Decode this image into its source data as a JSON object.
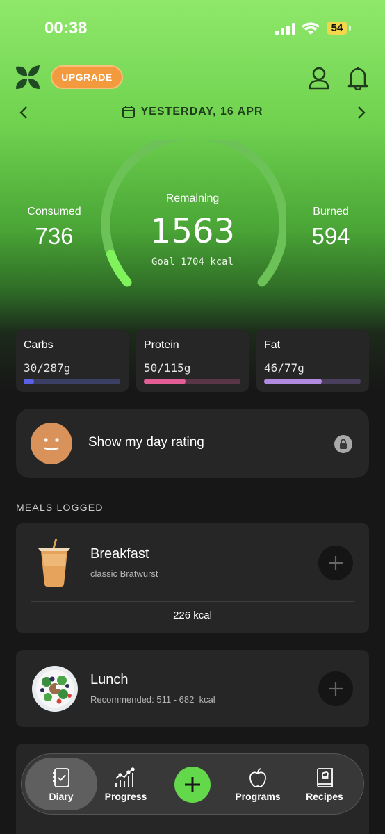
{
  "status": {
    "time": "00:38",
    "battery": "54"
  },
  "header": {
    "upgrade_label": "UPGRADE",
    "date": "YESTERDAY, 16 APR"
  },
  "stats": {
    "consumed_label": "Consumed",
    "consumed": "736",
    "remaining_label": "Remaining",
    "remaining": "1563",
    "goal": "Goal 1704 kcal",
    "burned_label": "Burned",
    "burned": "594",
    "remaining_progress": 0.08
  },
  "macros": [
    {
      "name": "Carbs",
      "value": "30/287g",
      "progress": 0.105,
      "color": "#5a61e6",
      "track": "#3b3f63"
    },
    {
      "name": "Protein",
      "value": "50/115g",
      "progress": 0.435,
      "color": "#e35e95",
      "track": "#5a3547"
    },
    {
      "name": "Fat",
      "value": "46/77g",
      "progress": 0.6,
      "color": "#b08be0",
      "track": "#4a3f5c"
    }
  ],
  "rating": {
    "label": "Show my day rating"
  },
  "meals_title": "MEALS LOGGED",
  "meals": [
    {
      "name": "Breakfast",
      "subtitle": "classic Bratwurst",
      "kcal": "226 kcal"
    },
    {
      "name": "Lunch",
      "subtitle": "Recommended: 511 - 682  kcal"
    }
  ],
  "nav": {
    "diary": "Diary",
    "progress": "Progress",
    "programs": "Programs",
    "recipes": "Recipes"
  },
  "colors": {
    "accent": "#62d84a",
    "upgrade": "#f39a3e",
    "card": "#262626"
  }
}
